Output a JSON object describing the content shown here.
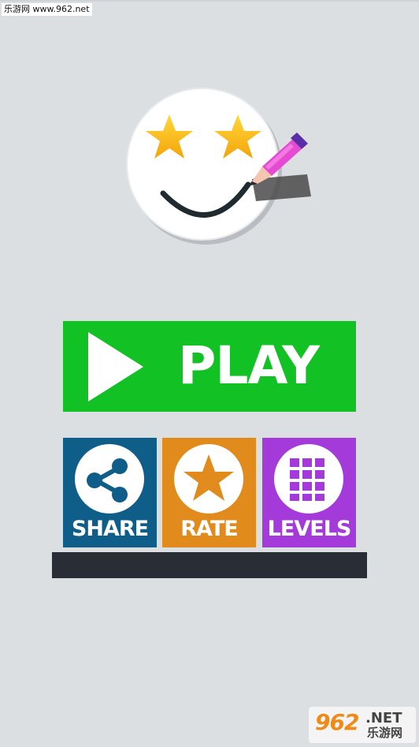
{
  "watermark": {
    "top_text": "乐游网 www.962.net",
    "bottom_number": "962",
    "bottom_domain": ".NET",
    "bottom_name": "乐游网"
  },
  "logo": {
    "icons": [
      "smiley-face-icon",
      "star-icon",
      "star-icon",
      "pencil-icon"
    ]
  },
  "menu": {
    "play_label": "PLAY",
    "share_label": "SHARE",
    "rate_label": "RATE",
    "levels_label": "LEVELS"
  },
  "colors": {
    "background": "#dcdfe2",
    "play": "#12c124",
    "share": "#0f5e8a",
    "rate": "#e18b1c",
    "levels": "#a43ad9",
    "ad_bar": "#282d36"
  }
}
